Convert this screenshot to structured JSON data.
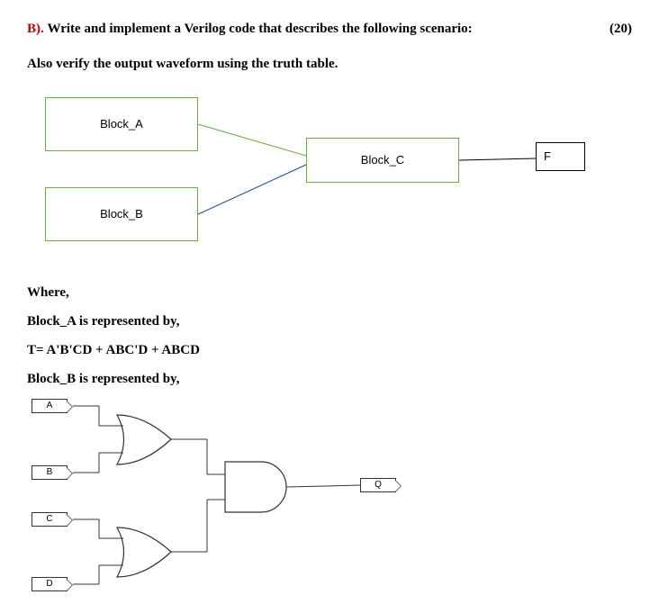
{
  "question": {
    "label": "B).",
    "text": "Write and implement a Verilog code that describes the following scenario:",
    "points": "(20)",
    "subtext": "Also verify the output waveform using the truth table."
  },
  "blocks": {
    "a": "Block_A",
    "b": "Block_B",
    "c": "Block_C",
    "f": "F"
  },
  "where": {
    "heading": "Where,",
    "block_a_rep": "Block_A is represented by,",
    "equation_t": "T= A'B'CD + ABC'D + ABCD",
    "block_b_rep": "Block_B is represented by,"
  },
  "gate_labels": {
    "a": "A",
    "b": "B",
    "c": "C",
    "d": "D",
    "q": "Q"
  }
}
